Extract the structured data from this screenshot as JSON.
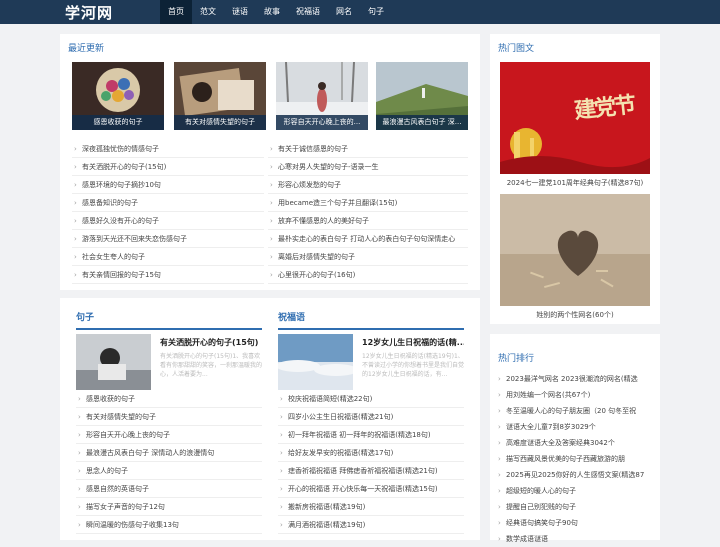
{
  "site": {
    "logo": "学河网"
  },
  "nav": [
    "首页",
    "范文",
    "谜语",
    "故事",
    "祝福语",
    "网名",
    "句子"
  ],
  "recent": {
    "title": "最近更新",
    "cards": [
      "感恩收获的句子",
      "有关对感情失望的句子",
      "形容自天开心晚上丧的...",
      "最浪漫古风表白句子 深..."
    ],
    "list_left": [
      "深夜孤独忧伤的情感句子",
      "有关洒脱开心的句子(15句)",
      "感恩环境的句子摘抄10句",
      "感恩备知识的句子",
      "感恩好久没有开心的句子",
      "游落到天光还不回来失恋伤感句子",
      "社会女生夸人的句子",
      "有关亲情回报的句子15句"
    ],
    "list_right": [
      "有关于诚信感恩的句子",
      "心寒对男人失望的句子-语录一生",
      "形容心烦发愁的句子",
      "用became造三个句子并且翻译(15句)",
      "放弃不懂感恩的人的美好句子",
      "最朴实走心的表白句子 打动人心的表白句子句句深情走心",
      "离婚后对感情失望的句子",
      "心里很开心的句子(16句)"
    ]
  },
  "juzi": {
    "title": "句子",
    "feature_title": "有关洒脱开心的句子(15句)",
    "feature_desc": "有关洒脱开心的句子(15句)1、我喜欢看有你那甜甜的笑容，一刹那温暖我的心，人活着要为...",
    "list": [
      "感恩收获的句子",
      "有关对感情失望的句子",
      "形容自天开心晚上丧的句子",
      "最浪漫古风表白句子 深情动人的浪漫情句",
      "思念人的句子",
      "感恩自然的英语句子",
      "描写女子声音的句子12句",
      "瞬间温暖的伤感句子收集13句"
    ]
  },
  "zhufu": {
    "title": "祝福语",
    "feature_title": "12岁女儿生日祝福的话(精...",
    "feature_desc": "12岁女儿生日祝福的话(精选19句)1、不曾读过小学的你想着书里是我们自觉的12岁女儿生日祝福的话，有...",
    "list": [
      "校庆祝福语简短(精选22句)",
      "四岁小公主生日祝福语(精选21句)",
      "初一拜年祝福语 初一拜年的祝福语(精选18句)",
      "给好友发早安的祝福语(精选17句)",
      "痣香祈福祝福语 拜佛痣香祈福祝福语(精选21句)",
      "开心的祝福语 开心快乐每一天祝福语(精选15句)",
      "搬新房祝福语(精选19句)",
      "满月酒祝福语(精选19句)"
    ]
  },
  "hot_images": {
    "title": "热门图文",
    "items": [
      {
        "caption": "2024七一建党101周年经典句子(精选87句)",
        "img_text": "建党节"
      },
      {
        "caption": "姓别的两个性网名(60个)"
      }
    ]
  },
  "hot_rank": {
    "title": "热门排行",
    "items": [
      "2023最洋气网名 2023很潮流的网名(精选",
      "用刘姓编一个网名(共67个)",
      "冬至温暖人心的句子朋友圈（20 句冬至祝",
      "谜语大全儿童7到8岁3029个",
      "高难度谜语大全及答案经典3042个",
      "描写西藏风景优美的句子西藏旅游的朋",
      "2025再见2025你好的人生感悟文案(精选87",
      "超级短的暖人心的句子",
      "提醒自己别犯贱的句子",
      "经典语句搞笑句子90句",
      "数学成语谜语"
    ]
  },
  "colors": {
    "header": "#1f3a57",
    "accent": "#2f6db0",
    "nav_active": "#0c2236"
  }
}
